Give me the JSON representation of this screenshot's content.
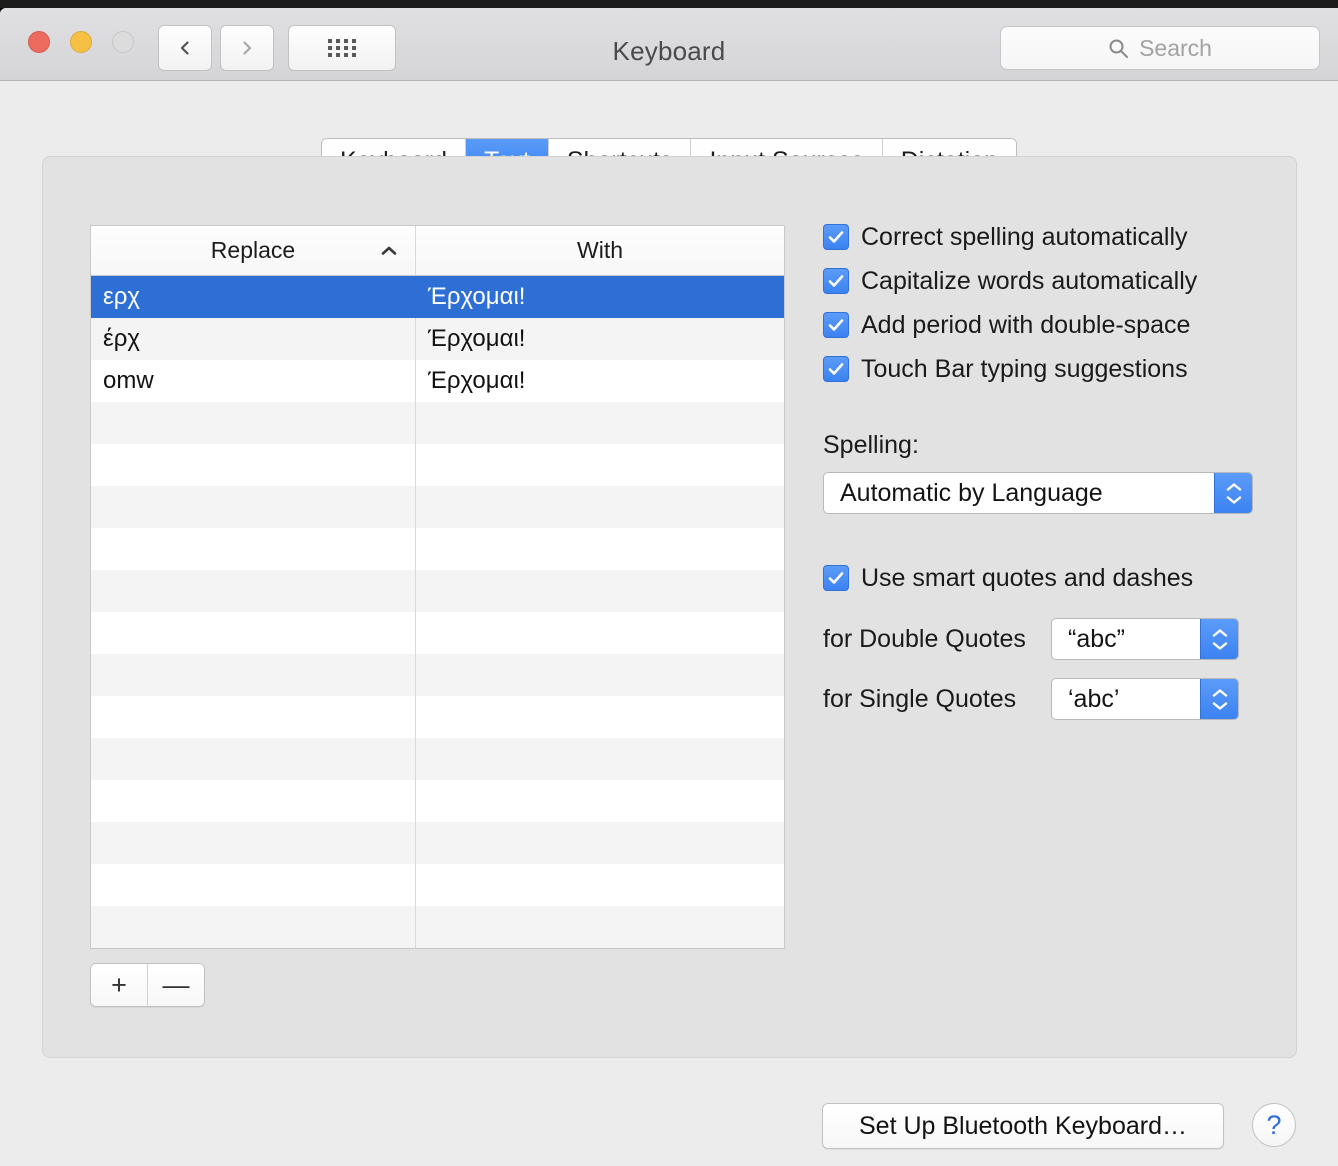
{
  "window": {
    "title": "Keyboard",
    "traffic_lights": [
      "close-button",
      "minimize-button",
      "zoom-button"
    ],
    "colors": {
      "close": "#ed6a5e",
      "minimize": "#f5c044",
      "zoom": "#dcdcdc",
      "accent": "#2d6fd4",
      "tab_active": "#2f7ff0",
      "window_bg": "#ececec",
      "panel_bg": "#e2e2e2"
    }
  },
  "toolbar": {
    "back_icon": "chevron-left-icon",
    "forward_icon": "chevron-right-icon",
    "show_all_icon": "grid-dots-icon",
    "search": {
      "icon": "search-icon",
      "placeholder": "Search",
      "value": ""
    }
  },
  "tabs": [
    {
      "label": "Keyboard",
      "active": false
    },
    {
      "label": "Text",
      "active": true
    },
    {
      "label": "Shortcuts",
      "active": false
    },
    {
      "label": "Input Sources",
      "active": false
    },
    {
      "label": "Dictation",
      "active": false
    }
  ],
  "table": {
    "columns": [
      {
        "label": "Replace",
        "sort": "ascending",
        "sort_icon": "chevron-up-icon"
      },
      {
        "label": "With",
        "sort": "none"
      }
    ],
    "rows": [
      {
        "replace": "ερχ",
        "with": "Έρχομαι!",
        "selected": true
      },
      {
        "replace": "έρχ",
        "with": "Έρχομαι!",
        "selected": false
      },
      {
        "replace": "omw",
        "with": "Έρχομαι!",
        "selected": false
      }
    ],
    "empty_row_count": 14
  },
  "list_controls": {
    "add_label": "+",
    "remove_label": "—"
  },
  "options": {
    "checkboxes": [
      {
        "label": "Correct spelling automatically",
        "checked": true
      },
      {
        "label": "Capitalize words automatically",
        "checked": true
      },
      {
        "label": "Add period with double-space",
        "checked": true
      },
      {
        "label": "Touch Bar typing suggestions",
        "checked": true
      }
    ],
    "spelling": {
      "label": "Spelling:",
      "value": "Automatic by Language"
    },
    "smart_quotes": {
      "checkbox_label": "Use smart quotes and dashes",
      "checked": true,
      "double": {
        "label": "for Double Quotes",
        "value": "“abc”"
      },
      "single": {
        "label": "for Single Quotes",
        "value": "‘abc’"
      }
    }
  },
  "footer": {
    "bluetooth_button": "Set Up Bluetooth Keyboard…",
    "help_button": "?"
  }
}
